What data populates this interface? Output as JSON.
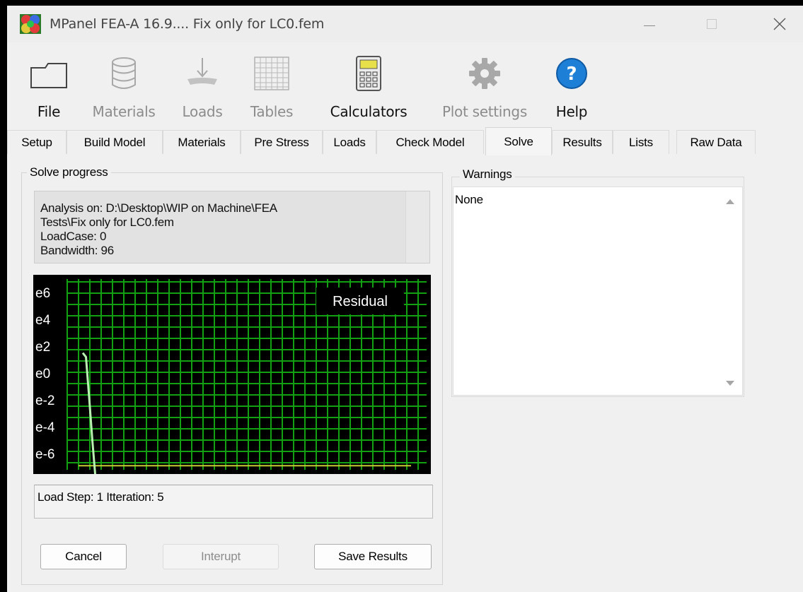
{
  "window": {
    "title": "MPanel FEA-A 16.9.... Fix only for LC0.fem"
  },
  "toolbar": {
    "items": [
      {
        "label": "File",
        "icon": "folder-icon",
        "enabled": true
      },
      {
        "label": "Materials",
        "icon": "database-icon",
        "enabled": false
      },
      {
        "label": "Loads",
        "icon": "load-arrow-icon",
        "enabled": false
      },
      {
        "label": "Tables",
        "icon": "table-grid-icon",
        "enabled": false
      },
      {
        "label": "Calculators",
        "icon": "calculator-icon",
        "enabled": true
      },
      {
        "label": "Plot settings",
        "icon": "gear-icon",
        "enabled": false
      },
      {
        "label": "Help",
        "icon": "help-icon",
        "enabled": true
      }
    ]
  },
  "tabs": [
    {
      "label": "Setup"
    },
    {
      "label": "Build Model"
    },
    {
      "label": "Materials"
    },
    {
      "label": "Pre Stress"
    },
    {
      "label": "Loads"
    },
    {
      "label": "Check Model"
    },
    {
      "label": "Solve",
      "active": true
    },
    {
      "label": "Results"
    },
    {
      "label": "Lists"
    },
    {
      "label": "Raw Data"
    }
  ],
  "solve_progress": {
    "title": "Solve progress",
    "info_lines": [
      "Analysis on: D:\\Desktop\\WIP on Machine\\FEA",
      "Tests\\Fix only for LC0.fem",
      "LoadCase:  0",
      "Bandwidth:  96"
    ],
    "status": "Load Step: 1   Itteration: 5",
    "buttons": {
      "cancel": "Cancel",
      "interupt": "Interupt",
      "save": "Save Results"
    }
  },
  "warnings": {
    "title": "Warnings",
    "text": "None"
  },
  "chart_data": {
    "type": "line",
    "scale": "log",
    "ytick_labels": [
      "e6",
      "e4",
      "e2",
      "e0",
      "e-2",
      "e-4",
      "e-6"
    ],
    "ytick_exponents": [
      6,
      4,
      2,
      0,
      -2,
      -4,
      -6
    ],
    "ylim_exponent": [
      -7.2,
      7.0
    ],
    "grid": true,
    "legend": "top-right",
    "series": [
      {
        "name": "Residual",
        "x": [
          1,
          2,
          3,
          4,
          5
        ],
        "log10_y": [
          1.5,
          1.2,
          -1.8,
          -5.0,
          -8.0
        ]
      }
    ],
    "tolerance_log10": -6.9,
    "colors": {
      "background": "#000000",
      "grid": "#12a012",
      "line": "#b8f0b0",
      "tolerance": "#c7cb33"
    }
  },
  "colors": {
    "help_blue": "#1e7fd6",
    "calculator_yellow": "#e8e04a"
  }
}
